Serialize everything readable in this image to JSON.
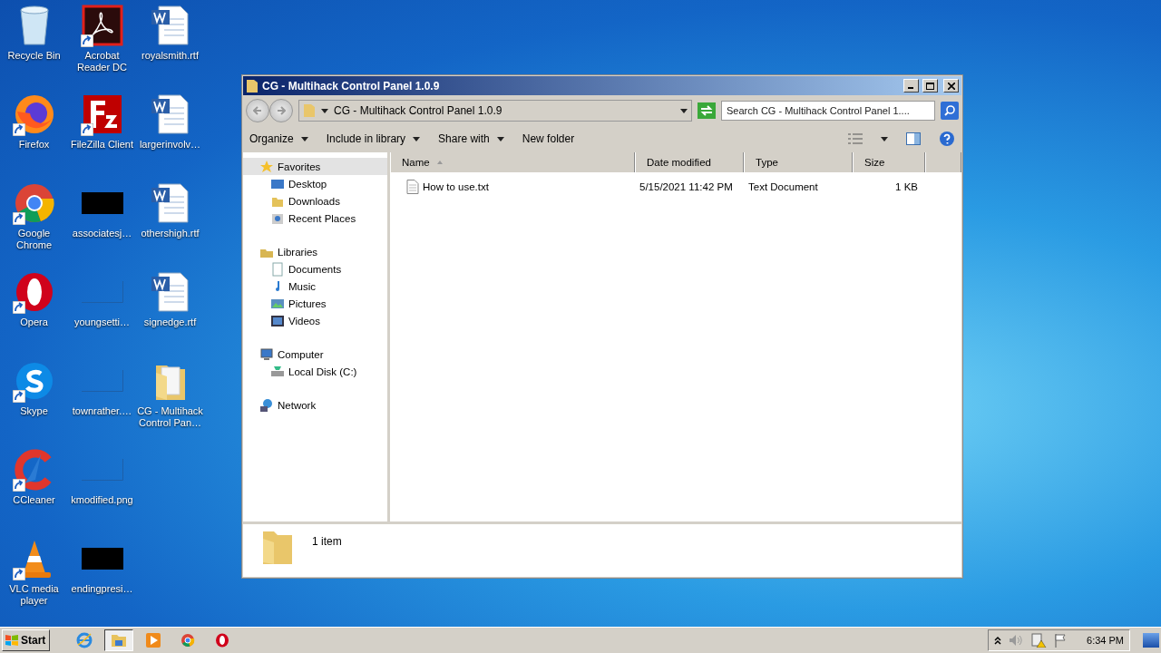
{
  "desktop": {
    "icons": [
      {
        "kind": "recycle-bin",
        "label": "Recycle Bin",
        "shortcut": false
      },
      {
        "kind": "firefox",
        "label": "Firefox",
        "shortcut": true
      },
      {
        "kind": "chrome",
        "label": "Google Chrome",
        "shortcut": true
      },
      {
        "kind": "opera",
        "label": "Opera",
        "shortcut": true
      },
      {
        "kind": "skype",
        "label": "Skype",
        "shortcut": true
      },
      {
        "kind": "ccleaner",
        "label": "CCleaner",
        "shortcut": true
      },
      {
        "kind": "vlc",
        "label": "VLC media player",
        "shortcut": true
      },
      {
        "kind": "acrobat",
        "label": "Acrobat Reader DC",
        "shortcut": true
      },
      {
        "kind": "filezilla",
        "label": "FileZilla Client",
        "shortcut": true
      },
      {
        "kind": "black-thumb",
        "label": "associatesj…",
        "shortcut": false
      },
      {
        "kind": "blank-thumb",
        "label": "youngsetti…",
        "shortcut": false
      },
      {
        "kind": "blank-thumb",
        "label": "townrather.…",
        "shortcut": false
      },
      {
        "kind": "blank-thumb",
        "label": "kmodified.png",
        "shortcut": false
      },
      {
        "kind": "black-thumb",
        "label": "endingpresi…",
        "shortcut": false
      },
      {
        "kind": "word-doc",
        "label": "royalsmith.rtf",
        "shortcut": false
      },
      {
        "kind": "word-doc",
        "label": "largerinvolv…",
        "shortcut": false
      },
      {
        "kind": "word-doc",
        "label": "othershigh.rtf",
        "shortcut": false
      },
      {
        "kind": "word-doc",
        "label": "signedge.rtf",
        "shortcut": false
      },
      {
        "kind": "folder",
        "label": "CG - Multihack Control Pan…",
        "shortcut": false
      }
    ]
  },
  "window": {
    "title": "CG - Multihack Control Panel 1.0.9",
    "address": "CG - Multihack Control Panel 1.0.9",
    "search": {
      "placeholder": "Search CG - Multihack Control Panel 1...."
    },
    "toolbar": [
      {
        "label": "Organize",
        "has_menu": true
      },
      {
        "label": "Include in library",
        "has_menu": true
      },
      {
        "label": "Share with",
        "has_menu": true
      },
      {
        "label": "New folder",
        "has_menu": false
      }
    ],
    "nav": [
      {
        "kind": "favorites",
        "label": "Favorites",
        "selected": true,
        "children": [
          {
            "kind": "desktop",
            "label": "Desktop",
            "selected": false
          },
          {
            "kind": "downloads",
            "label": "Downloads",
            "selected": false
          },
          {
            "kind": "recent",
            "label": "Recent Places",
            "selected": false
          }
        ]
      },
      {
        "kind": "libraries",
        "label": "Libraries",
        "selected": false,
        "children": [
          {
            "kind": "documents",
            "label": "Documents",
            "selected": false
          },
          {
            "kind": "music",
            "label": "Music",
            "selected": false
          },
          {
            "kind": "pictures",
            "label": "Pictures",
            "selected": false
          },
          {
            "kind": "videos",
            "label": "Videos",
            "selected": false
          }
        ]
      },
      {
        "kind": "computer",
        "label": "Computer",
        "selected": false,
        "children": [
          {
            "kind": "disk",
            "label": "Local Disk (C:)",
            "selected": false
          }
        ]
      },
      {
        "kind": "network",
        "label": "Network",
        "selected": false
      }
    ],
    "columns": [
      {
        "label": "Name",
        "sorted": true
      },
      {
        "label": "Date modified",
        "sorted": false
      },
      {
        "label": "Type",
        "sorted": false
      },
      {
        "label": "Size",
        "sorted": false
      }
    ],
    "rows": [
      {
        "selected": false,
        "cells": [
          "How to use.txt",
          "5/15/2021 11:42 PM",
          "Text Document",
          "1 KB"
        ]
      }
    ],
    "details": {
      "count": "1 item"
    }
  },
  "taskbar": {
    "start": "Start",
    "apps": [
      {
        "kind": "ie",
        "active": false
      },
      {
        "kind": "explorer",
        "active": true
      },
      {
        "kind": "media",
        "active": false
      },
      {
        "kind": "chrome",
        "active": false
      },
      {
        "kind": "opera",
        "active": false
      }
    ],
    "tray": [
      {
        "kind": "chevron"
      },
      {
        "kind": "speaker"
      },
      {
        "kind": "network-warning"
      },
      {
        "kind": "flag"
      }
    ],
    "clock": "6:34 PM"
  }
}
